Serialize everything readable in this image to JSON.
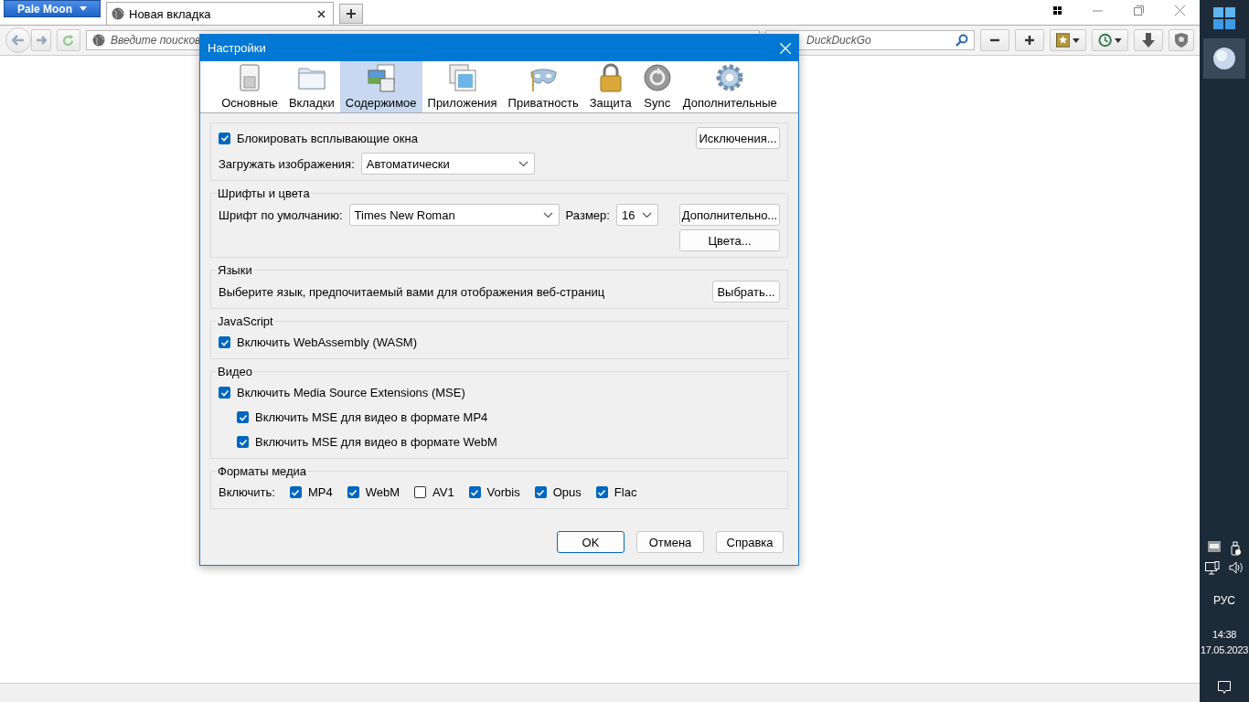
{
  "browser": {
    "menu_button": "Pale Moon",
    "tabs": [
      {
        "title": "Новая вкладка",
        "selected": true
      }
    ],
    "url_placeholder": "Введите поисков",
    "search_placeholder": "DuckDuckGo"
  },
  "dialog": {
    "title": "Настройки",
    "panes": [
      {
        "label": "Основные",
        "selected": false
      },
      {
        "label": "Вкладки",
        "selected": false
      },
      {
        "label": "Содержимое",
        "selected": true
      },
      {
        "label": "Приложения",
        "selected": false
      },
      {
        "label": "Приватность",
        "selected": false
      },
      {
        "label": "Защита",
        "selected": false
      },
      {
        "label": "Sync",
        "selected": false
      },
      {
        "label": "Дополнительные",
        "selected": false
      }
    ],
    "block_popups": {
      "label": "Блокировать всплывающие окна",
      "checked": true
    },
    "exceptions_button": "Исключения...",
    "load_images": {
      "label": "Загружать изображения:",
      "value": "Автоматически"
    },
    "fonts": {
      "title": "Шрифты и цвета",
      "default_font_label": "Шрифт по умолчанию:",
      "default_font": "Times New Roman",
      "size_label": "Размер:",
      "size": "16",
      "advanced_button": "Дополнительно...",
      "colors_button": "Цвета..."
    },
    "languages": {
      "title": "Языки",
      "description": "Выберите язык, предпочитаемый вами для отображения веб-страниц",
      "choose_button": "Выбрать..."
    },
    "javascript": {
      "title": "JavaScript",
      "wasm": {
        "label": "Включить WebAssembly (WASM)",
        "checked": true
      }
    },
    "video": {
      "title": "Видео",
      "options": [
        {
          "label": "Включить Media Source Extensions (MSE)",
          "checked": true,
          "children": [
            {
              "label": "Включить MSE для видео в формате MP4",
              "checked": true
            },
            {
              "label": "Включить MSE для видео в формате WebM",
              "checked": true
            }
          ]
        }
      ]
    },
    "media_formats": {
      "title": "Форматы медиа",
      "label": "Включить:",
      "formats": [
        {
          "label": "MP4",
          "checked": true
        },
        {
          "label": "WebM",
          "checked": true
        },
        {
          "label": "AV1",
          "checked": false
        },
        {
          "label": "Vorbis",
          "checked": true
        },
        {
          "label": "Opus",
          "checked": true
        },
        {
          "label": "Flac",
          "checked": true
        }
      ]
    },
    "buttons": [
      {
        "label": "OK",
        "default": true
      },
      {
        "label": "Отмена",
        "default": false
      },
      {
        "label": "Справка",
        "default": false
      }
    ]
  },
  "taskbar": {
    "language": "РУС",
    "time": "14:38",
    "date": "17.05.2023"
  }
}
